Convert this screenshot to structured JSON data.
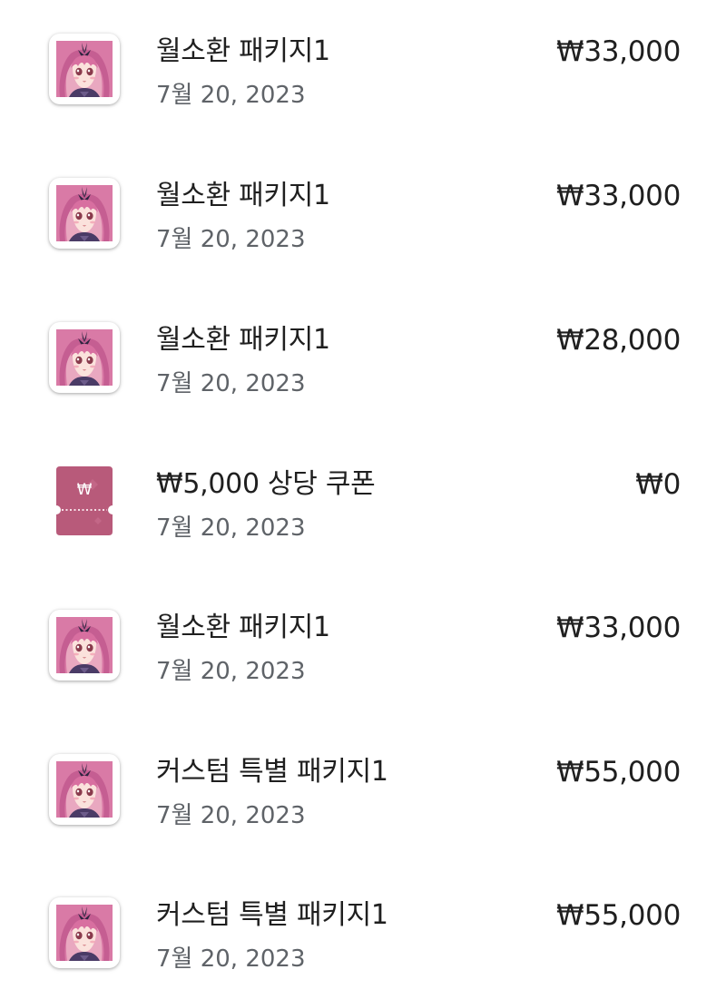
{
  "purchases": [
    {
      "title": "월소환 패키지1",
      "date": "7월 20, 2023",
      "price": "₩33,000",
      "icon": "game-app-icon"
    },
    {
      "title": "월소환 패키지1",
      "date": "7월 20, 2023",
      "price": "₩33,000",
      "icon": "game-app-icon"
    },
    {
      "title": "월소환 패키지1",
      "date": "7월 20, 2023",
      "price": "₩28,000",
      "icon": "game-app-icon"
    },
    {
      "title": "₩5,000 상당 쿠폰",
      "date": "7월 20, 2023",
      "price": "₩0",
      "icon": "coupon-icon",
      "coupon_symbol": "₩",
      "coupon_color": "#b85a7a"
    },
    {
      "title": "월소환 패키지1",
      "date": "7월 20, 2023",
      "price": "₩33,000",
      "icon": "game-app-icon"
    },
    {
      "title": "커스텀 특별 패키지1",
      "date": "7월 20, 2023",
      "price": "₩55,000",
      "icon": "game-app-icon"
    },
    {
      "title": "커스텀 특별 패키지1",
      "date": "7월 20, 2023",
      "price": "₩55,000",
      "icon": "game-app-icon"
    }
  ]
}
